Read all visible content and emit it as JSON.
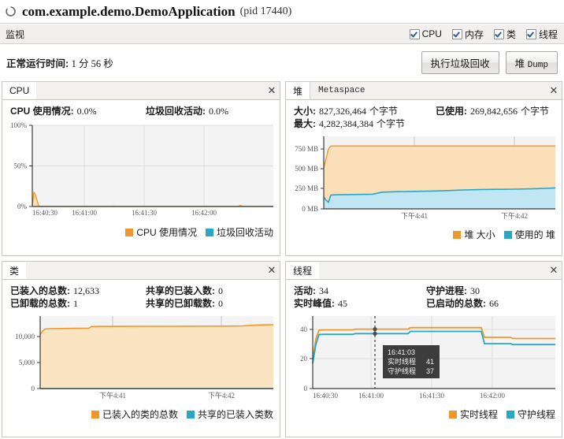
{
  "window": {
    "icon": "spinner-icon",
    "title": "com.example.demo.DemoApplication",
    "pid_label": "(pid 17440)"
  },
  "toolbar": {
    "label": "监视",
    "checkboxes": [
      {
        "label": "CPU",
        "checked": true
      },
      {
        "label": "内存",
        "checked": true
      },
      {
        "label": "类",
        "checked": true
      },
      {
        "label": "线程",
        "checked": true
      }
    ]
  },
  "uptime": {
    "key": "正常运行时间:",
    "value": "1 分 56 秒"
  },
  "actions": {
    "gc_label": "执行垃圾回收",
    "heapdump_prefix": "堆",
    "heapdump_mono": "Dump"
  },
  "colors": {
    "orange": "#f0962d",
    "orange_fill": "#fadfb9",
    "blue": "#29a8c4",
    "blue_fill": "#bfe6f2",
    "plot_bg": "#f4f4f4",
    "grid": "#dcdcdc",
    "axis": "#3a3a3a",
    "tooltip_bg": "#3c3c3c"
  },
  "panels": {
    "cpu": {
      "title": "CPU",
      "close": "✕",
      "stats": [
        [
          {
            "key": "CPU 使用情况:",
            "value": "0.0%"
          },
          {
            "key": "垃圾回收活动:",
            "value": "0.0%"
          }
        ]
      ],
      "legend": [
        {
          "label": "CPU 使用情况",
          "color": "#f0962d"
        },
        {
          "label": "垃圾回收活动",
          "color": "#29a8c4"
        }
      ]
    },
    "heap": {
      "title": "堆",
      "tab_inactive": "Metaspace",
      "close": "✕",
      "stats": [
        [
          {
            "key": "大小:",
            "value": "827,326,464",
            "unit": "个字节"
          },
          {
            "key": "已使用:",
            "value": "269,842,656",
            "unit": "个字节"
          }
        ],
        [
          {
            "key": "最大:",
            "value": "4,282,384,384",
            "unit": "个字节"
          }
        ]
      ],
      "legend": [
        {
          "label": "堆 大小",
          "color": "#f0962d"
        },
        {
          "label": "使用的 堆",
          "color": "#29a8c4"
        }
      ]
    },
    "classes": {
      "title": "类",
      "close": "✕",
      "stats": [
        [
          {
            "key": "已装入的总数:",
            "value": "12,633"
          },
          {
            "key": "共享的已装入数:",
            "value": "0"
          }
        ],
        [
          {
            "key": "已卸载的总数:",
            "value": "1"
          },
          {
            "key": "共享的已卸载数:",
            "value": "0"
          }
        ]
      ],
      "legend": [
        {
          "label": "已装入的类的总数",
          "color": "#f0962d"
        },
        {
          "label": "共享的已装入类数",
          "color": "#29a8c4"
        }
      ]
    },
    "threads": {
      "title": "线程",
      "close": "✕",
      "stats": [
        [
          {
            "key": "活动:",
            "value": "34"
          },
          {
            "key": "守护进程:",
            "value": "30"
          }
        ],
        [
          {
            "key": "实时峰值:",
            "value": "45"
          },
          {
            "key": "已启动的总数:",
            "value": "66"
          }
        ]
      ],
      "legend": [
        {
          "label": "实时线程",
          "color": "#f0962d"
        },
        {
          "label": "守护线程",
          "color": "#29a8c4"
        }
      ],
      "tooltip": {
        "time": "16:41:03",
        "rows": [
          {
            "label": "实时线程",
            "value": "41"
          },
          {
            "label": "守护线程",
            "value": "37"
          }
        ]
      }
    }
  },
  "chart_data": [
    {
      "id": "cpu",
      "type": "area",
      "title": "CPU",
      "xlabel": "",
      "ylabel": "",
      "ylim": [
        0,
        100
      ],
      "yticks": [
        0,
        50,
        100
      ],
      "ytick_labels": [
        "0%",
        "50%",
        "100%"
      ],
      "xtick_labels": [
        "16:40:30",
        "16:41:00",
        "16:41:30",
        "16:42:00"
      ],
      "grid": true,
      "legend_position": "bottom-right",
      "x": [
        0,
        2,
        4,
        6,
        8,
        12,
        20,
        30,
        40,
        50,
        60,
        70,
        80,
        90,
        100,
        110,
        116,
        120
      ],
      "series": [
        {
          "name": "CPU 使用情况",
          "color": "#f0962d",
          "values": [
            0,
            17,
            14,
            8,
            1,
            0,
            0,
            0,
            0,
            0.4,
            0,
            0,
            0,
            0,
            0,
            0,
            1.2,
            0.3
          ]
        },
        {
          "name": "垃圾回收活动",
          "color": "#29a8c4",
          "values": [
            0,
            2,
            1,
            0.5,
            0,
            0,
            0,
            0,
            0,
            0,
            0,
            0,
            0,
            0,
            0,
            0,
            0,
            0
          ]
        }
      ]
    },
    {
      "id": "heap",
      "type": "area",
      "title": "堆",
      "xlabel": "",
      "ylabel": "",
      "ylim": [
        0,
        900
      ],
      "yticks": [
        0,
        250,
        500,
        750
      ],
      "ytick_labels": [
        "0 MB",
        "250 MB",
        "500 MB",
        "750 MB"
      ],
      "xtick_labels": [
        "下午4:41",
        "下午4:42"
      ],
      "grid": true,
      "legend_position": "bottom-right",
      "x": [
        0,
        2,
        4,
        6,
        10,
        20,
        30,
        36,
        44,
        56,
        68,
        78,
        86,
        96,
        104,
        112,
        120
      ],
      "series": [
        {
          "name": "堆 大小",
          "color": "#f0962d",
          "values": [
            520,
            640,
            760,
            789,
            789,
            789,
            789,
            789,
            789,
            789,
            789,
            789,
            789,
            789,
            789,
            789,
            789
          ]
        },
        {
          "name": "使用的 堆",
          "color": "#29a8c4",
          "values": [
            150,
            110,
            85,
            175,
            178,
            180,
            182,
            212,
            218,
            222,
            225,
            230,
            238,
            240,
            243,
            248,
            257
          ]
        }
      ]
    },
    {
      "id": "classes",
      "type": "area",
      "title": "类",
      "xlabel": "",
      "ylabel": "",
      "ylim": [
        0,
        14000
      ],
      "yticks": [
        0,
        5000,
        10000
      ],
      "ytick_labels": [
        "0",
        "5,000",
        "10,000"
      ],
      "xtick_labels": [
        "下午4:41",
        "下午4:42"
      ],
      "grid": true,
      "legend_position": "bottom-right",
      "x": [
        0,
        2,
        4,
        8,
        16,
        28,
        34,
        40,
        60,
        80,
        100,
        110,
        116,
        120
      ],
      "series": [
        {
          "name": "已装入的类的总数",
          "color": "#f0962d",
          "values": [
            10400,
            11600,
            12200,
            12280,
            12300,
            12320,
            12480,
            12490,
            12500,
            12510,
            12520,
            12560,
            12620,
            12633
          ]
        },
        {
          "name": "共享的已装入类数",
          "color": "#29a8c4",
          "values": [
            0,
            0,
            0,
            0,
            0,
            0,
            0,
            0,
            0,
            0,
            0,
            0,
            0,
            0
          ]
        }
      ]
    },
    {
      "id": "threads",
      "type": "line",
      "title": "线程",
      "xlabel": "",
      "ylabel": "",
      "ylim": [
        0,
        48
      ],
      "yticks": [
        0,
        20,
        40
      ],
      "ytick_labels": [
        "0",
        "20",
        "40"
      ],
      "xtick_labels": [
        "16:40:30",
        "16:41:00",
        "16:41:30",
        "16:42:00"
      ],
      "grid": true,
      "legend_position": "bottom-right",
      "marker_x": "16:41:03",
      "x": [
        0,
        2,
        4,
        6,
        10,
        22,
        26,
        34,
        40,
        46,
        52,
        56,
        62,
        70,
        82,
        90,
        96,
        100,
        106,
        112,
        120
      ],
      "series": [
        {
          "name": "实时线程",
          "color": "#f0962d",
          "values": [
            20,
            34,
            40,
            40,
            40,
            40,
            41,
            41,
            41,
            41,
            41,
            42,
            42,
            42,
            42,
            42,
            35,
            35,
            35,
            34,
            34
          ]
        },
        {
          "name": "守护线程",
          "color": "#29a8c4",
          "values": [
            17,
            31,
            37,
            37,
            37,
            37,
            38,
            38,
            37,
            37,
            37,
            39,
            39,
            39,
            39,
            39,
            31,
            31,
            31,
            30,
            30
          ]
        }
      ]
    }
  ]
}
